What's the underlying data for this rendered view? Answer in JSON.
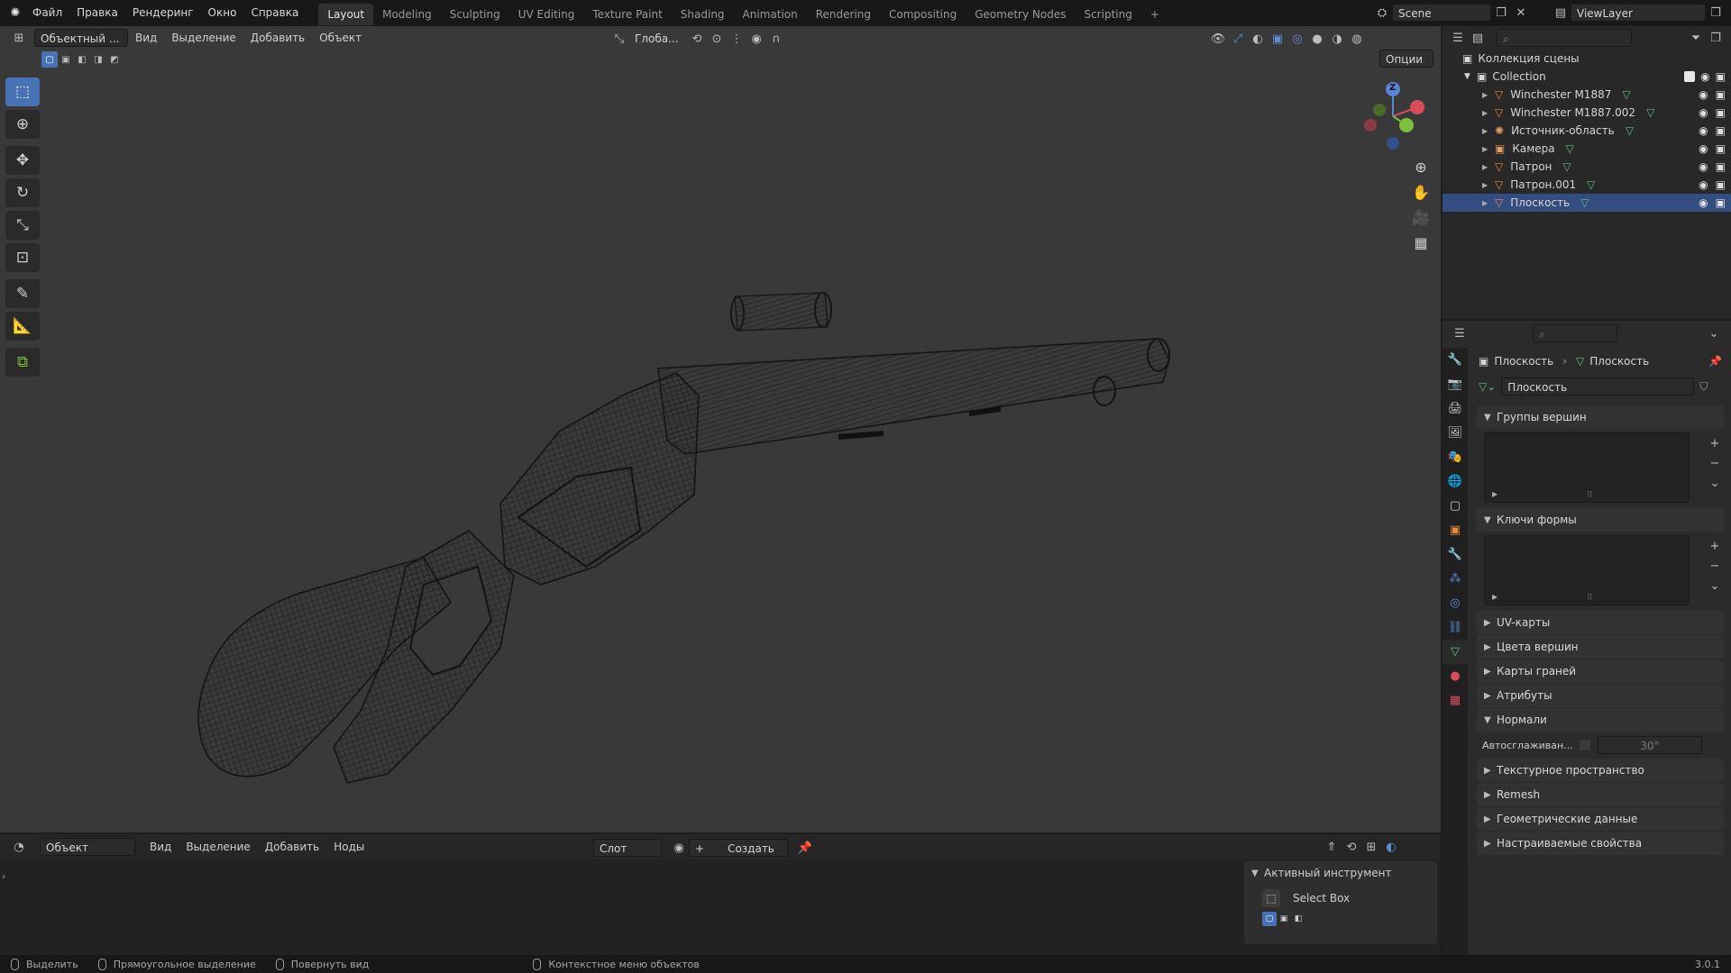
{
  "topbar": {
    "menus": [
      "Файл",
      "Правка",
      "Рендеринг",
      "Окно",
      "Справка"
    ],
    "workspaces": [
      "Layout",
      "Modeling",
      "Sculpting",
      "UV Editing",
      "Texture Paint",
      "Shading",
      "Animation",
      "Rendering",
      "Compositing",
      "Geometry Nodes",
      "Scripting"
    ],
    "active_workspace": "Layout",
    "add_tab": "+",
    "scene_name": "Scene",
    "view_layer": "ViewLayer"
  },
  "viewport": {
    "mode": "Объектный ...",
    "menus": [
      "Вид",
      "Выделение",
      "Добавить",
      "Объект"
    ],
    "orientation": "Глоба...",
    "options": "Опции"
  },
  "gizmo": {
    "z": "Z"
  },
  "outliner": {
    "title": "Коллекция сцены",
    "collection": "Collection",
    "items": [
      {
        "name": "Winchester M1887",
        "icon": "mesh-icon",
        "selected": false
      },
      {
        "name": "Winchester M1887.002",
        "icon": "mesh-icon",
        "selected": false
      },
      {
        "name": "Источник-область",
        "icon": "light-icon",
        "selected": false
      },
      {
        "name": "Камера",
        "icon": "camera-icon",
        "selected": false
      },
      {
        "name": "Патрон",
        "icon": "mesh-icon",
        "selected": false
      },
      {
        "name": "Патрон.001",
        "icon": "mesh-icon",
        "selected": false
      },
      {
        "name": "Плоскость",
        "icon": "mesh-icon",
        "selected": true
      }
    ]
  },
  "properties": {
    "breadcrumb_object": "Плоскость",
    "breadcrumb_data": "Плоскость",
    "datablock_name": "Плоскость",
    "vertex_groups": "Группы вершин",
    "shape_keys": "Ключи формы",
    "collapsed_panels": [
      "UV-карты",
      "Цвета вершин",
      "Карты граней",
      "Атрибуты"
    ],
    "normals": "Нормали",
    "autosmooth_label": "Автосглаживан...",
    "autosmooth_angle": "30°",
    "more_panels": [
      "Текстурное пространство",
      "Remesh",
      "Геометрические данные",
      "Настраиваемые свойства"
    ]
  },
  "bottom_editor": {
    "mode": "Объект",
    "menus": [
      "Вид",
      "Выделение",
      "Добавить",
      "Ноды"
    ],
    "slot": "Слот",
    "create": "Создать"
  },
  "active_tool": {
    "title": "Активный инструмент",
    "tool_name": "Select Box"
  },
  "status_bar": {
    "items": [
      "Выделить",
      "Прямоугольное выделение",
      "Повернуть вид",
      "Контекстное меню объектов"
    ],
    "version": "3.0.1"
  },
  "colors": {
    "accent": "#4772b3",
    "selection_row": "#334d80",
    "viewport_bg": "#393939",
    "mesh_icon": "#e78a3c",
    "data_icon": "#5fbf7f"
  }
}
